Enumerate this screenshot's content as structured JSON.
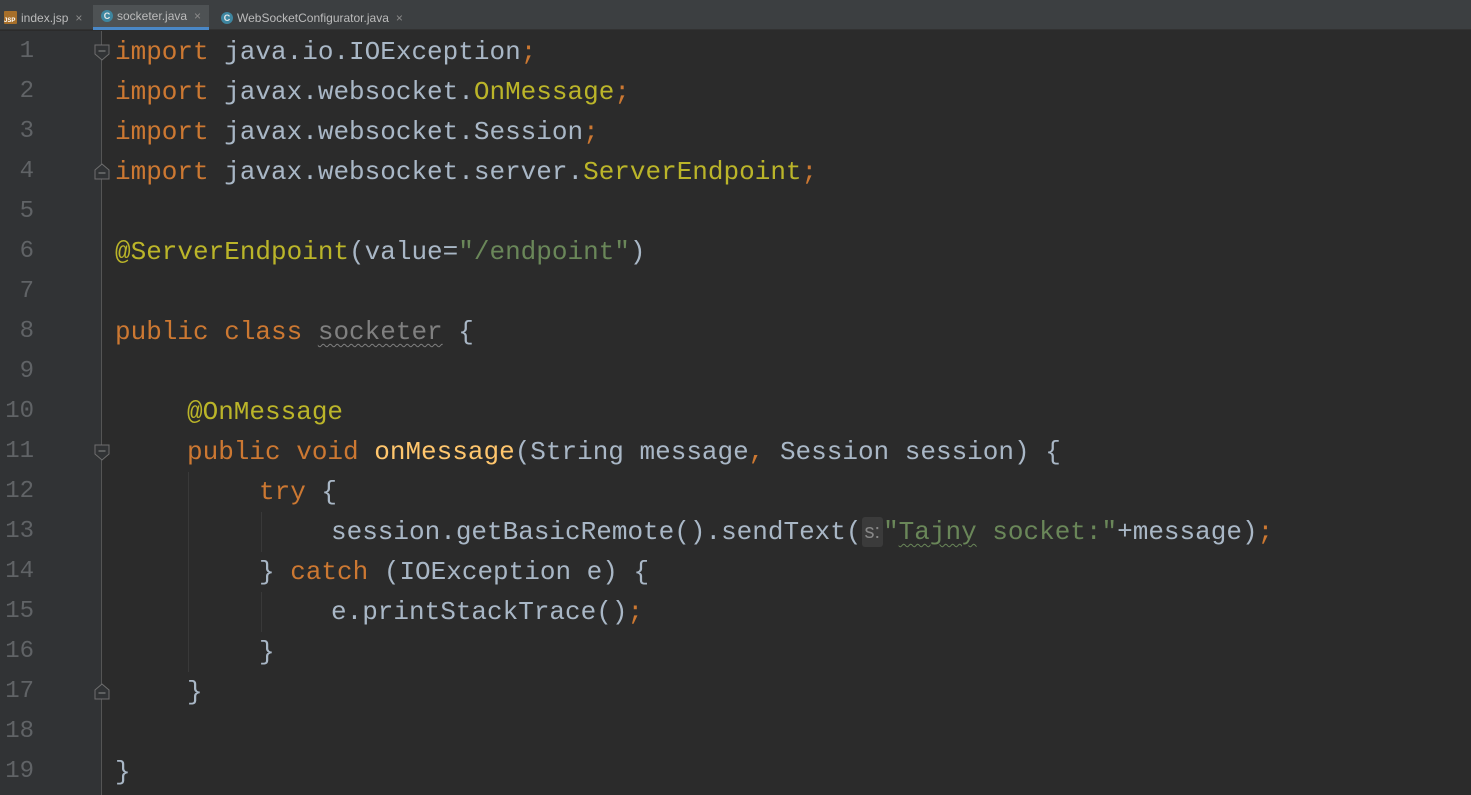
{
  "tabs": [
    {
      "label": "index.jsp",
      "icon": "jsp-file-icon",
      "active": false
    },
    {
      "label": "socketer.java",
      "icon": "java-class-icon",
      "active": true
    },
    {
      "label": "WebSocketConfigurator.java",
      "icon": "java-class-icon",
      "active": false
    }
  ],
  "close_glyph": "×",
  "line_numbers": [
    "1",
    "2",
    "3",
    "4",
    "5",
    "6",
    "7",
    "8",
    "9",
    "10",
    "11",
    "12",
    "13",
    "14",
    "15",
    "16",
    "17",
    "18",
    "19"
  ],
  "code": {
    "l1": {
      "kw": "import",
      "pkg": " java.io.IOException",
      "semi": ";"
    },
    "l2": {
      "kw": "import",
      "pkg": " javax.websocket.",
      "cls": "OnMessage",
      "semi": ";"
    },
    "l3": {
      "kw": "import",
      "pkg": " javax.websocket.Session",
      "semi": ";"
    },
    "l4": {
      "kw": "import",
      "pkg": " javax.websocket.server.",
      "cls": "ServerEndpoint",
      "semi": ";"
    },
    "l6": {
      "ann": "@ServerEndpoint",
      "open": "(value=",
      "str": "\"/endpoint\"",
      "close": ")"
    },
    "l8": {
      "kw": "public class",
      "name": "socketer",
      "brace": " {"
    },
    "l10": {
      "ann": "@OnMessage"
    },
    "l11": {
      "kw": "public void",
      "fn": "onMessage",
      "args": "(String message",
      "comma": ",",
      "args2": " Session session) {"
    },
    "l12": {
      "kw": "try",
      "brace": " {"
    },
    "l13": {
      "call": "session.getBasicRemote().sendText(",
      "hint": "s:",
      "q": "\"",
      "str_typo": "Tajny",
      "str_rest": " socket:\"",
      "rest": "+message)",
      "semi": ";"
    },
    "l14": {
      "pre": "} ",
      "kw": "catch",
      "rest": " (IOException e) {"
    },
    "l15": {
      "call": "e.printStackTrace()",
      "semi": ";"
    },
    "l16": {
      "brace": "}"
    },
    "l17": {
      "brace": "}"
    },
    "l19": {
      "brace": "}"
    }
  }
}
